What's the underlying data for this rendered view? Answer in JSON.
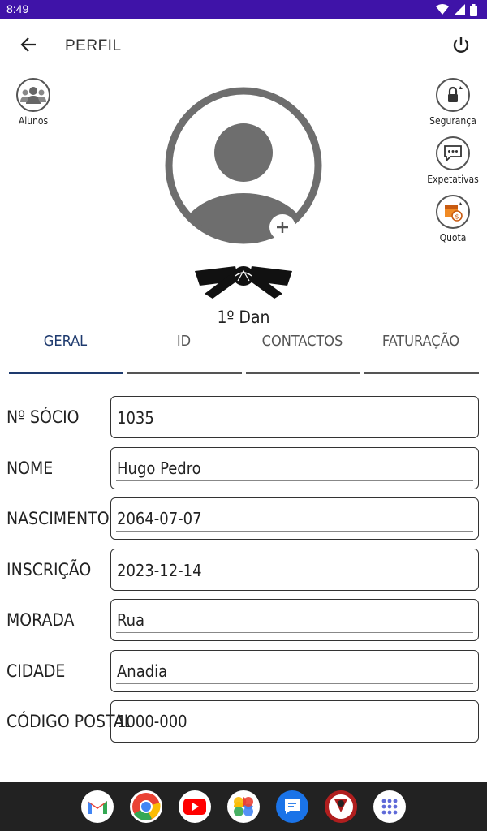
{
  "status_bar": {
    "time": "8:49"
  },
  "app_bar": {
    "title": "PERFIL"
  },
  "left_actions": [
    {
      "label": "Alunos"
    }
  ],
  "right_actions": [
    {
      "label": "Segurança"
    },
    {
      "label": "Expetativas"
    },
    {
      "label": "Quota"
    }
  ],
  "profile": {
    "rank": "1º Dan"
  },
  "tabs": [
    {
      "label": "GERAL",
      "active": true
    },
    {
      "label": "ID",
      "active": false
    },
    {
      "label": "CONTACTOS",
      "active": false
    },
    {
      "label": "FATURAÇÃO",
      "active": false
    }
  ],
  "form": {
    "rows": [
      {
        "label": "Nº SÓCIO",
        "value": "1035"
      },
      {
        "label": "NOME",
        "value": "Hugo Pedro"
      },
      {
        "label": "NASCIMENTO",
        "value": "2064-07-07"
      },
      {
        "label": "INSCRIÇÃO",
        "value": "2023-12-14"
      },
      {
        "label": "MORADA",
        "value": "Rua"
      },
      {
        "label": "CIDADE",
        "value": "Anadia"
      },
      {
        "label": "CÓDIGO POSTAL",
        "value": "1000-000"
      }
    ]
  },
  "colors": {
    "status_bar": "#3f13a8",
    "active_tab": "#1e3a6e",
    "nav_bar": "#222222"
  },
  "dock_apps": [
    "gmail-icon",
    "chrome-icon",
    "youtube-icon",
    "photos-icon",
    "messages-icon",
    "dojo-app-icon",
    "app-drawer-icon"
  ]
}
